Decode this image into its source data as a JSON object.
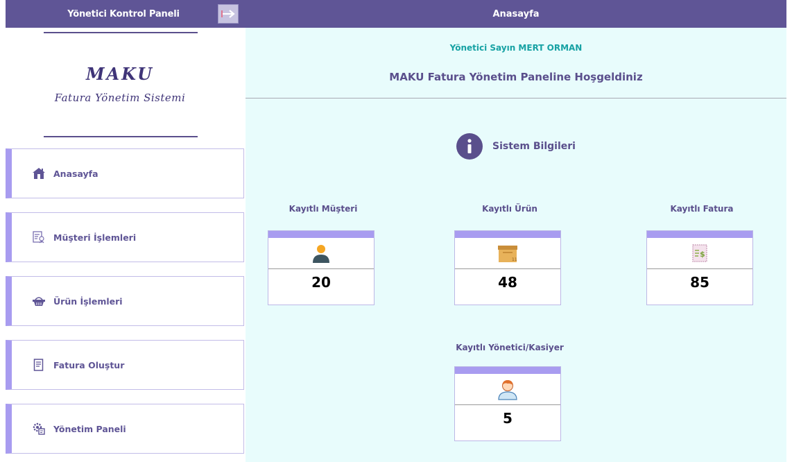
{
  "header": {
    "left_title": "Yönetici Kontrol Paneli",
    "page_title": "Anasayfa"
  },
  "logo": {
    "main": "MAKU",
    "sub": "Fatura Yönetim Sistemi"
  },
  "sidebar": {
    "items": [
      {
        "label": "Anasayfa",
        "icon": "home-icon"
      },
      {
        "label": "Müşteri İşlemleri",
        "icon": "customer-list-icon"
      },
      {
        "label": "Ürün İşlemleri",
        "icon": "basket-icon"
      },
      {
        "label": "Fatura Oluştur",
        "icon": "invoice-icon"
      },
      {
        "label": "Yönetim Paneli",
        "icon": "admin-gear-icon"
      }
    ]
  },
  "main": {
    "greeting": "Yönetici Sayın MERT ORMAN",
    "welcome": "MAKU Fatura Yönetim Paneline Hoşgeldiniz",
    "info_title": "Sistem Bilgileri",
    "stats": [
      {
        "label": "Kayıtlı Müşteri",
        "value": "20",
        "icon": "user-icon"
      },
      {
        "label": "Kayıtlı Ürün",
        "value": "48",
        "icon": "box-icon"
      },
      {
        "label": "Kayıtlı Fatura",
        "value": "85",
        "icon": "receipt-icon"
      },
      {
        "label": "Kayıtlı Yönetici/Kasiyer",
        "value": "5",
        "icon": "cashier-icon"
      }
    ]
  },
  "colors": {
    "header_bg": "#5f5596",
    "accent": "#a89cf0",
    "main_bg": "#e8fcfc",
    "greeting_text": "#17a2a4"
  }
}
